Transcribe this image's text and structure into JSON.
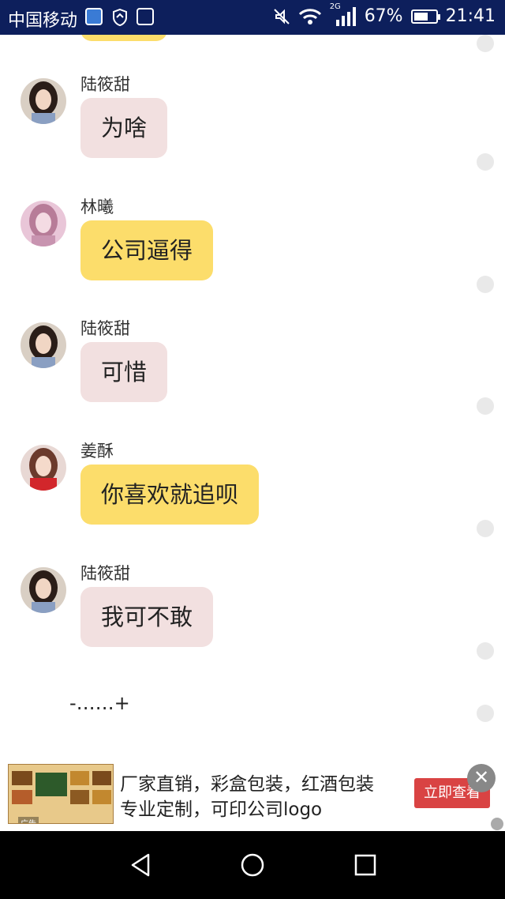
{
  "status_bar": {
    "carrier": "中国移动",
    "network_badge": "2G",
    "battery_percent": 67,
    "battery_label": "67%",
    "time": "21:41"
  },
  "chat": {
    "messages": [
      {
        "sender": "陆筱甜",
        "text": "为啥",
        "style": "pink"
      },
      {
        "sender": "林曦",
        "text": "公司逼得",
        "style": "yellow"
      },
      {
        "sender": "陆筱甜",
        "text": "可惜",
        "style": "pink"
      },
      {
        "sender": "姜酥",
        "text": "你喜欢就追呗",
        "style": "yellow"
      },
      {
        "sender": "陆筱甜",
        "text": "我可不敢",
        "style": "pink"
      }
    ],
    "typing_indicator": "-……+"
  },
  "ad": {
    "line1": "厂家直销，彩盒包装，红酒包装",
    "line2": "专业定制，可印公司logo",
    "cta": "立即查看",
    "tag": "广告"
  },
  "colors": {
    "status_bar_bg": "#0d1f5c",
    "bubble_pink": "#f2e0e0",
    "bubble_yellow": "#fcdd6b",
    "cta_red": "#d94343"
  }
}
